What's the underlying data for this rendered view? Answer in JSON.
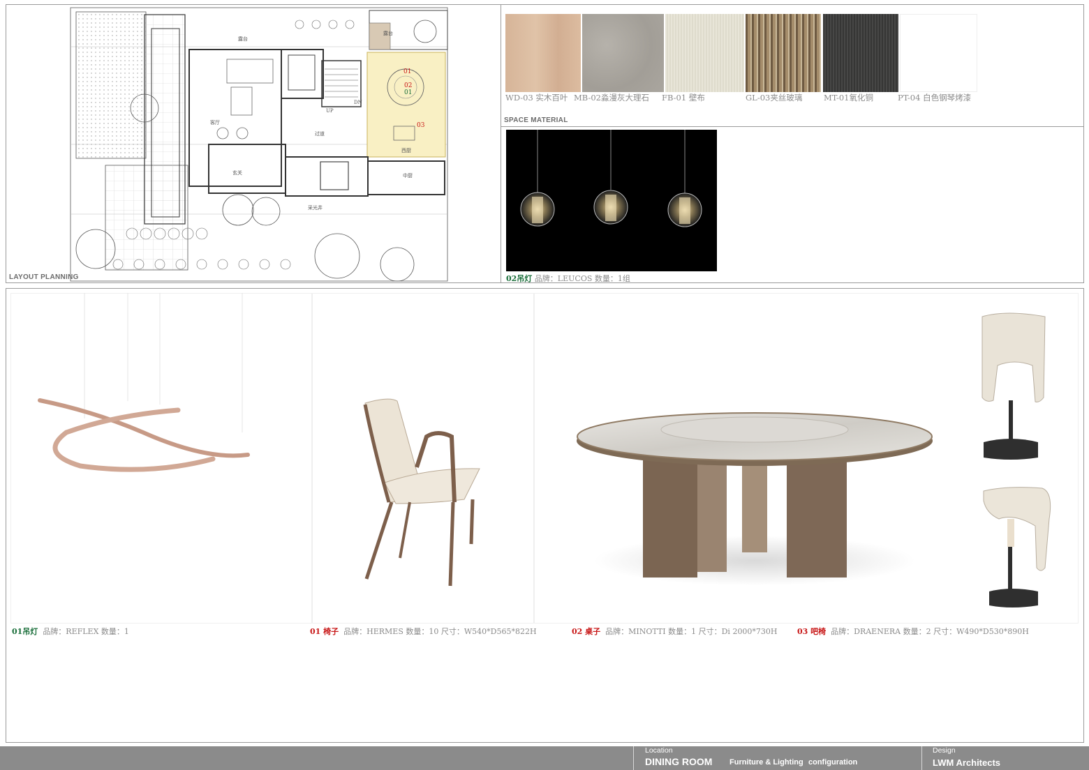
{
  "layout_planning": {
    "label": "LAYOUT PLANNING",
    "room_labels": {
      "terrace_top": "露台",
      "terrace_right": "露台",
      "living": "客厅",
      "hall": "过道",
      "entry": "玄关",
      "kitchen_west": "西厨",
      "kitchen_chinese": "中厨",
      "up": "UP",
      "dn": "DN",
      "courtyard": "采光井"
    },
    "markers": [
      "01",
      "02",
      "01",
      "03"
    ]
  },
  "space_material": {
    "label": "SPACE MATERIAL",
    "swatches": [
      {
        "code": "WD-03",
        "name": "实木百叶",
        "color": "#d8b79c"
      },
      {
        "code": "MB-02",
        "name": "淼漫灰大理石",
        "color": "#a9a59e"
      },
      {
        "code": "FB-01",
        "name": "壁布",
        "color": "#e6e3d6"
      },
      {
        "code": "GL-03",
        "name": "夹丝玻璃",
        "color": "#8a7457"
      },
      {
        "code": "MT-01",
        "name": "氧化铜",
        "color": "#3c3c3b"
      },
      {
        "code": "PT-04",
        "name": "白色钢琴烤漆",
        "color": "#ffffff"
      }
    ],
    "captions": [
      "WD-03 实木百叶",
      "MB-02淼漫灰大理石",
      "FB-01 壁布",
      "GL-03夹丝玻璃",
      "MT-01氧化铜",
      "PT-04 白色钢琴烤漆"
    ]
  },
  "pendant_02": {
    "code": "02吊灯",
    "detail": "品牌：LEUCOS 数量：1组"
  },
  "products": [
    {
      "code": "01吊灯",
      "detail": "品牌：REFLEX 数量：1"
    },
    {
      "code": "01 椅子",
      "detail": "品牌：HERMES 数量：10 尺寸：W540*D565*822H"
    },
    {
      "code": "02 桌子",
      "detail": "品牌：MINOTTI 数量：1 尺寸：Di 2000*730H"
    },
    {
      "code": "03 吧椅",
      "detail": "品牌：DRAENERA 数量：2 尺寸：W490*D530*890H"
    }
  ],
  "footer": {
    "location_label": "Location",
    "room_title": "DINING ROOM",
    "subtitle_a": "Furniture & Lighting",
    "subtitle_b": "configuration",
    "design_label": "Design",
    "firm": "LWM Architects"
  },
  "colors": {
    "green_code": "#1a6e3a",
    "red_code": "#c81818",
    "footer_bar": "#8b8b8b",
    "highlight_room": "#f9f0c4"
  }
}
